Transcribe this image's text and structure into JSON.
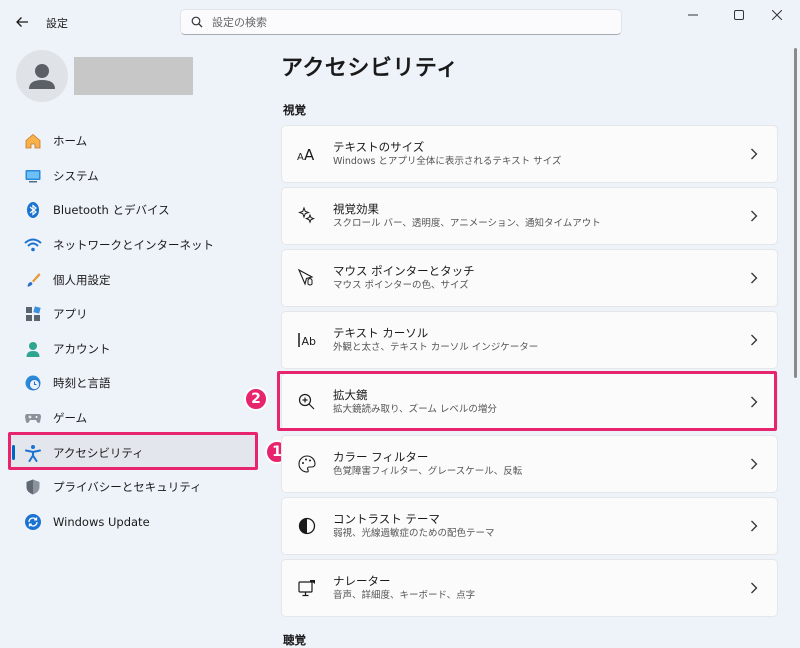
{
  "app": {
    "title": "設定"
  },
  "search": {
    "placeholder": "設定の検索"
  },
  "sidebar": {
    "items": [
      {
        "label": "ホーム",
        "icon": "home-icon"
      },
      {
        "label": "システム",
        "icon": "system-icon"
      },
      {
        "label": "Bluetooth とデバイス",
        "icon": "bluetooth-icon"
      },
      {
        "label": "ネットワークとインターネット",
        "icon": "wifi-icon"
      },
      {
        "label": "個人用設定",
        "icon": "brush-icon"
      },
      {
        "label": "アプリ",
        "icon": "apps-icon"
      },
      {
        "label": "アカウント",
        "icon": "account-icon"
      },
      {
        "label": "時刻と言語",
        "icon": "clock-globe-icon"
      },
      {
        "label": "ゲーム",
        "icon": "gamepad-icon"
      },
      {
        "label": "アクセシビリティ",
        "icon": "accessibility-icon",
        "active": true
      },
      {
        "label": "プライバシーとセキュリティ",
        "icon": "shield-icon"
      },
      {
        "label": "Windows Update",
        "icon": "update-icon"
      }
    ]
  },
  "main": {
    "title": "アクセシビリティ",
    "sections": {
      "vision": "視覚",
      "hearing": "聴覚"
    },
    "cards": [
      {
        "title": "テキストのサイズ",
        "subtitle": "Windows とアプリ全体に表示されるテキスト サイズ",
        "icon": "text-size-icon"
      },
      {
        "title": "視覚効果",
        "subtitle": "スクロール バー、透明度、アニメーション、通知タイムアウト",
        "icon": "visual-effects-icon"
      },
      {
        "title": "マウス ポインターとタッチ",
        "subtitle": "マウス ポインターの色、サイズ",
        "icon": "mouse-pointer-icon"
      },
      {
        "title": "テキスト カーソル",
        "subtitle": "外観と太さ、テキスト カーソル インジケーター",
        "icon": "text-cursor-icon"
      },
      {
        "title": "拡大鏡",
        "subtitle": "拡大鏡読み取り、ズーム レベルの増分",
        "icon": "magnifier-icon"
      },
      {
        "title": "カラー フィルター",
        "subtitle": "色覚障害フィルター、グレースケール、反転",
        "icon": "palette-icon"
      },
      {
        "title": "コントラスト テーマ",
        "subtitle": "弱視、光線過敏症のための配色テーマ",
        "icon": "contrast-icon"
      },
      {
        "title": "ナレーター",
        "subtitle": "音声、詳細度、キーボード、点字",
        "icon": "narrator-icon"
      }
    ]
  },
  "annotations": {
    "badge1": "1",
    "badge2": "2"
  },
  "colors": {
    "accent": "#0067c0",
    "highlight": "#e6256e",
    "background": "#eef2f9"
  }
}
